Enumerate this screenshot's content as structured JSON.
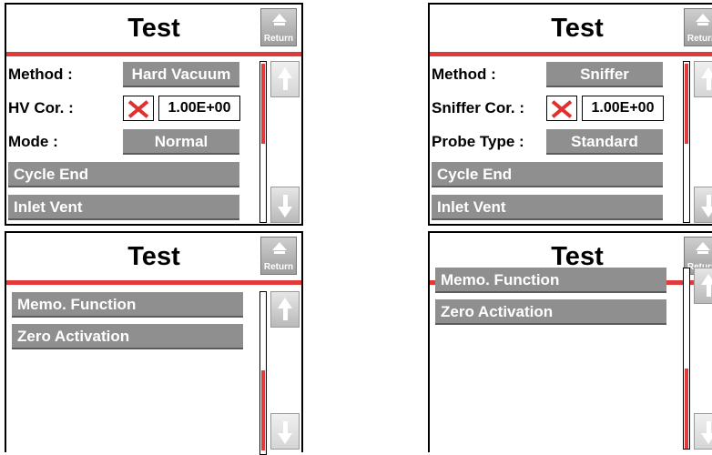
{
  "colors": {
    "accent_red": "#e03a3a",
    "button_gray": "#8f8f8f"
  },
  "return_label": "Return",
  "panels": {
    "top_left": {
      "title": "Test",
      "rows": {
        "method_label": "Method :",
        "method_value": "Hard Vacuum",
        "cor_label": "HV Cor. :",
        "cor_value": "1.00E+00",
        "third_label": "Mode :",
        "third_value": "Normal",
        "item1": "Cycle End",
        "item2": "Inlet Vent"
      }
    },
    "top_right": {
      "title": "Test",
      "rows": {
        "method_label": "Method :",
        "method_value": "Sniffer",
        "cor_label": "Sniffer Cor. :",
        "cor_value": "1.00E+00",
        "third_label": "Probe Type :",
        "third_value": "Standard",
        "item1": "Cycle End",
        "item2": "Inlet Vent"
      }
    },
    "bottom_left": {
      "title": "Test",
      "items": [
        "Memo. Function",
        "Zero Activation"
      ]
    },
    "bottom_right": {
      "title": "Test",
      "items": [
        "Memo. Function",
        "Zero Activation"
      ]
    }
  },
  "icons": [
    "return-icon",
    "up-arrow-icon",
    "down-arrow-icon",
    "cross-icon"
  ]
}
